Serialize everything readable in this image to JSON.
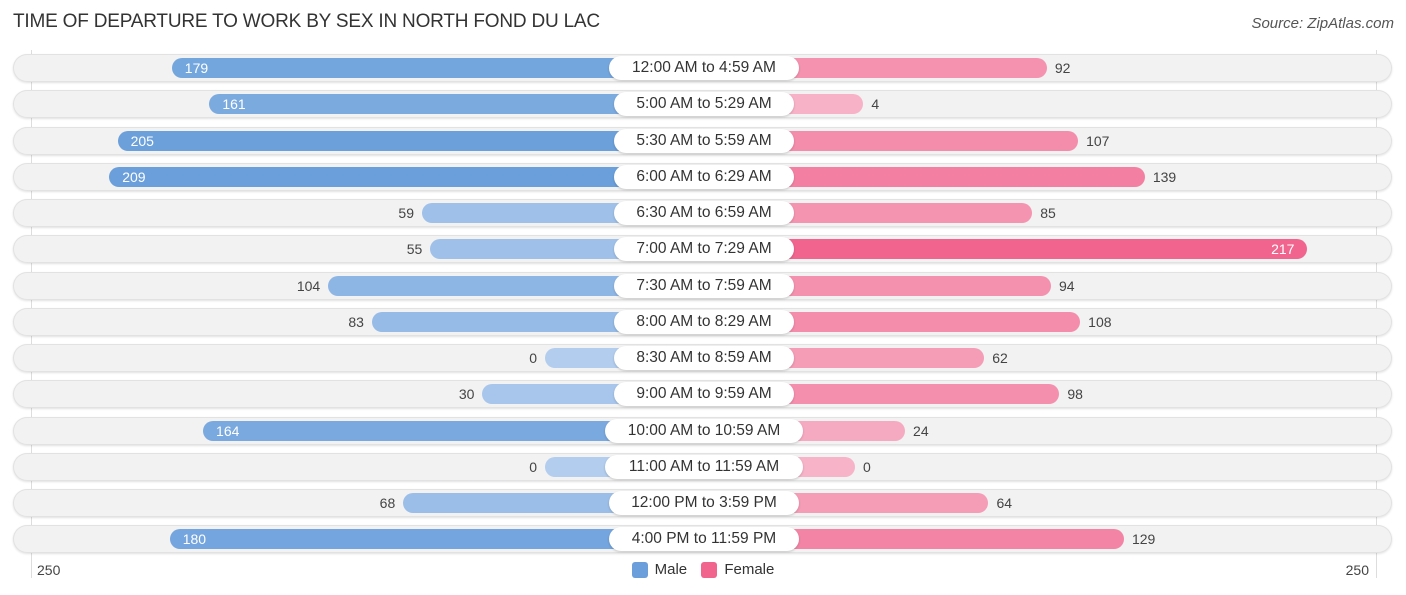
{
  "chart_data": {
    "type": "bar",
    "orientation": "horizontal-diverging",
    "title": "TIME OF DEPARTURE TO WORK BY SEX IN NORTH FOND DU LAC",
    "source": "Source: ZipAtlas.com",
    "categories": [
      "12:00 AM to 4:59 AM",
      "5:00 AM to 5:29 AM",
      "5:30 AM to 5:59 AM",
      "6:00 AM to 6:29 AM",
      "6:30 AM to 6:59 AM",
      "7:00 AM to 7:29 AM",
      "7:30 AM to 7:59 AM",
      "8:00 AM to 8:29 AM",
      "8:30 AM to 8:59 AM",
      "9:00 AM to 9:59 AM",
      "10:00 AM to 10:59 AM",
      "11:00 AM to 11:59 AM",
      "12:00 PM to 3:59 PM",
      "4:00 PM to 11:59 PM"
    ],
    "series": [
      {
        "name": "Male",
        "color": "#6a9fdb",
        "values": [
          179,
          161,
          205,
          209,
          59,
          55,
          104,
          83,
          0,
          30,
          164,
          0,
          68,
          180
        ]
      },
      {
        "name": "Female",
        "color": "#f0648e",
        "values": [
          92,
          4,
          107,
          139,
          85,
          217,
          94,
          108,
          62,
          98,
          24,
          0,
          64,
          129
        ]
      }
    ],
    "xlim": [
      250,
      250
    ],
    "axis_labels": {
      "left": "250",
      "right": "250"
    },
    "legend": {
      "position": "bottom-center",
      "items": [
        "Male",
        "Female"
      ]
    },
    "grid": false
  }
}
